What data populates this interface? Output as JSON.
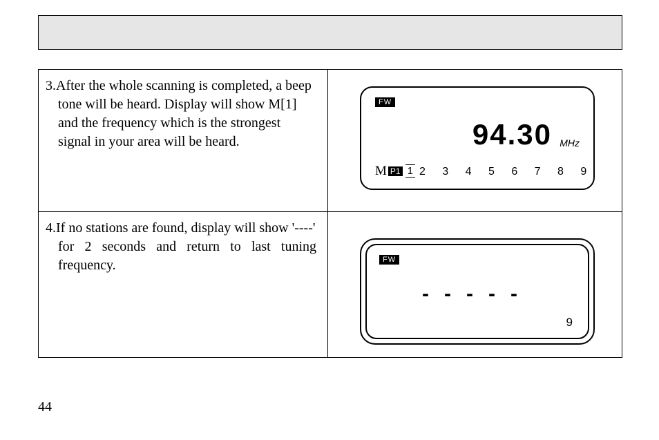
{
  "page_number": "44",
  "steps": [
    {
      "num": "3.",
      "text_line1": "After the whole scanning is completed, a beep",
      "text_rest": "tone will be heard. Display will show M[1] and the frequency which is the strongest signal in your area will be heard."
    },
    {
      "num": "4.",
      "text_line1": "If no stations are found, display will show '----'",
      "text_rest": "for 2 seconds and return to last tuning frequency."
    }
  ],
  "lcd1": {
    "fw": "FW",
    "frequency": "94.30",
    "unit": "MHz",
    "mem_prefix": "M",
    "p1": "P1",
    "selected": "1",
    "digits": "2  3  4  5  6  7  8  9"
  },
  "lcd2": {
    "fw": "FW",
    "dashes": "-----",
    "corner": "9"
  }
}
